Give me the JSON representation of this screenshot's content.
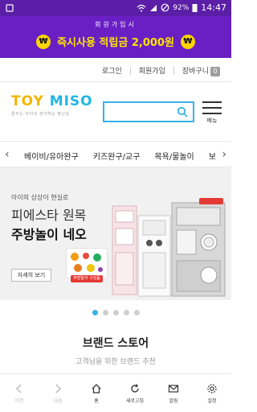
{
  "status": {
    "battery": "92%",
    "time": "14:47"
  },
  "promo": {
    "subtitle": "회원가입시",
    "coin_symbol": "₩",
    "headline": "즉시사용 적립금 2,000원"
  },
  "topnav": {
    "login": "로그인",
    "join": "회원가입",
    "cart": "장바구니",
    "cart_count": "0"
  },
  "header": {
    "logo_part1": "TOY",
    "logo_part2": "MISO",
    "logo_tagline": "꿈꾸는 아이의 생각하는 장난감",
    "menu_label": "메뉴"
  },
  "categories": [
    "베이비/유아완구",
    "키즈완구/교구",
    "목욕/물놀이",
    "보"
  ],
  "hero": {
    "small": "아이의 상상이 현실로",
    "line1": "피에스타 원목",
    "line2": "주방놀이 네오",
    "button": "자세히 보기",
    "product_tag": "주방놀이 구성품"
  },
  "brand_store": {
    "title": "브랜드 스토어",
    "subtitle": "고객님을 위한 브랜드 추천"
  },
  "bottom_nav": {
    "back": "이전",
    "forward": "다음",
    "home": "홈",
    "refresh": "새로고침",
    "mail": "알림",
    "settings": "설정"
  }
}
